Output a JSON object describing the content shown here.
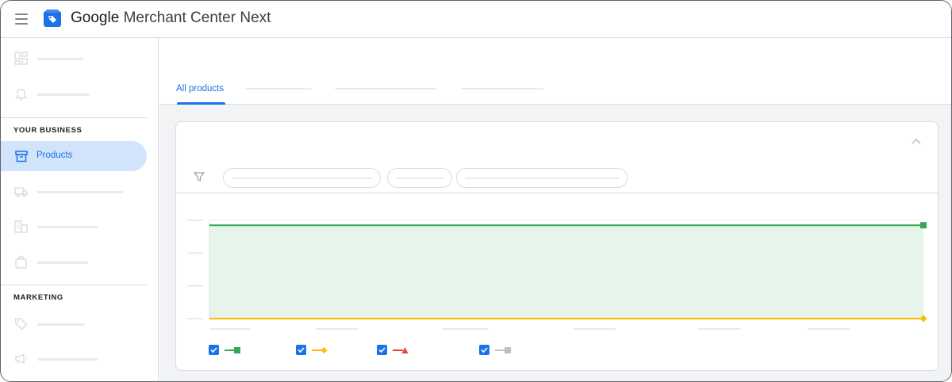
{
  "header": {
    "title_brand": "Google",
    "title_rest": "Merchant Center Next"
  },
  "sidebar": {
    "sections": [
      {
        "label": "YOUR BUSINESS"
      },
      {
        "label": "MARKETING"
      }
    ],
    "active_item": {
      "label": "Products"
    }
  },
  "tabs": {
    "active_label": "All products"
  },
  "colors": {
    "accent": "#1a73e8",
    "active_bg": "#d2e3fc",
    "series_green": "#34a853",
    "series_yellow": "#fbbc04",
    "series_red": "#ea4335",
    "series_grey": "#bdc1c6",
    "area_fill": "#e6f4ea"
  },
  "chart_data": {
    "type": "area",
    "title": "",
    "xlabel": "",
    "ylabel": "",
    "ylim": [
      0,
      100
    ],
    "grid": true,
    "legend_position": "bottom",
    "x": [
      0,
      1,
      2,
      3,
      4,
      5,
      6
    ],
    "series": [
      {
        "color": "#34a853",
        "marker": "square",
        "values": [
          95,
          95,
          95,
          95,
          95,
          95,
          95
        ],
        "checked": true
      },
      {
        "color": "#fbbc04",
        "marker": "diamond",
        "values": [
          0,
          0,
          0,
          0,
          0,
          0,
          0
        ],
        "checked": true
      },
      {
        "color": "#ea4335",
        "marker": "triangle",
        "values": [
          0,
          0,
          0,
          0,
          0,
          0,
          0
        ],
        "checked": true
      },
      {
        "color": "#bdc1c6",
        "marker": "square",
        "values": [
          0,
          0,
          0,
          0,
          0,
          0,
          0
        ],
        "checked": true
      }
    ]
  }
}
